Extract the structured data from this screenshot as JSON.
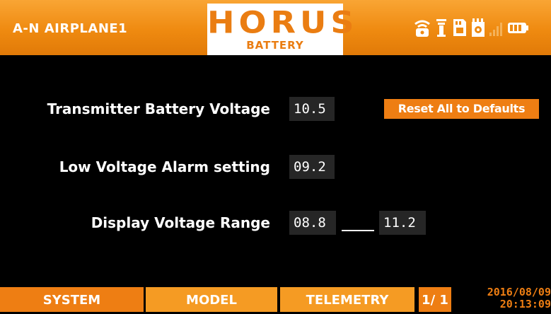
{
  "header": {
    "model_name": "A-N AIRPLANE1",
    "logo": "HORUS",
    "page_name": "BATTERY",
    "colors": {
      "accent": "#ee7e13",
      "header_top": "#f9a534",
      "header_bottom": "#e17a08"
    },
    "status_icons": [
      "wifi-icon",
      "antenna-icon",
      "sd-card-icon",
      "receiver-battery-icon",
      "signal-bars-icon",
      "battery-icon"
    ]
  },
  "settings": {
    "tx_voltage": {
      "label": "Transmitter Battery Voltage",
      "value": "10.5"
    },
    "low_alarm": {
      "label": "Low Voltage Alarm setting",
      "value": "09.2"
    },
    "display_range": {
      "label": "Display Voltage Range",
      "min": "08.8",
      "max": "11.2"
    },
    "reset_label": "Reset All to Defaults"
  },
  "footer": {
    "tabs": [
      "SYSTEM",
      "MODEL",
      "TELEMETRY"
    ],
    "page_indicator": "1/ 1",
    "date": "2016/08/09",
    "time": "20:13:09"
  }
}
